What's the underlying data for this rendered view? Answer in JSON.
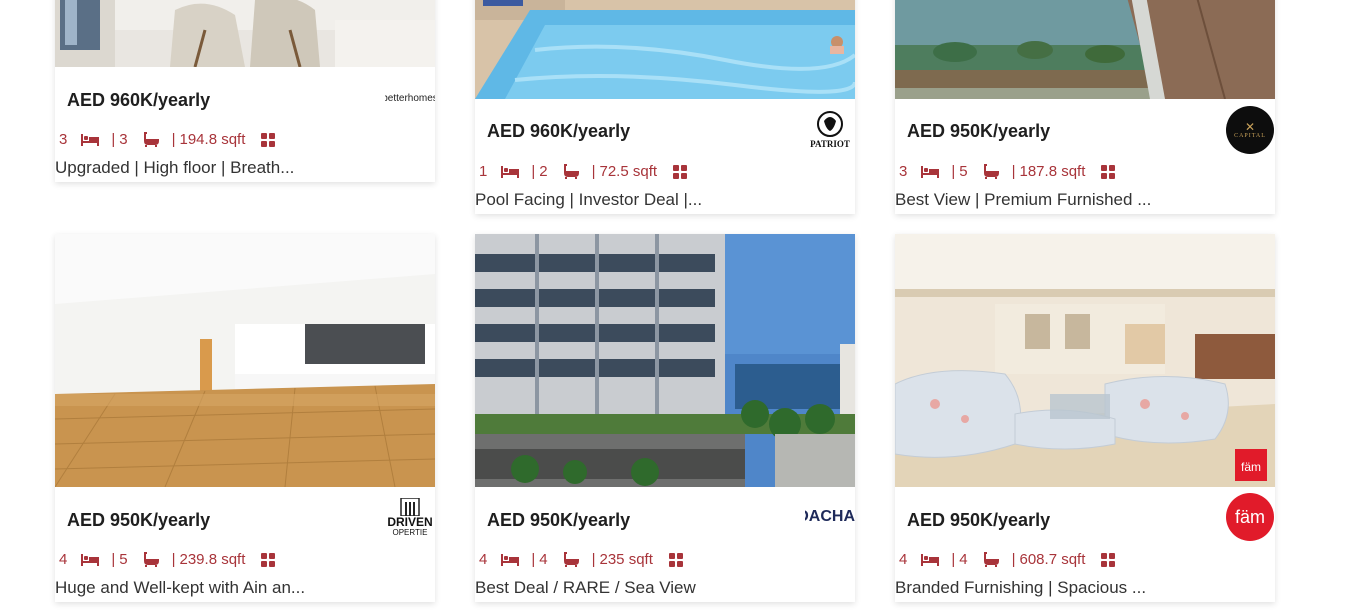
{
  "colors": {
    "accent": "#a8343a",
    "price": "#1f1f1f",
    "text": "#333333"
  },
  "listings": [
    {
      "price": "AED 960K/yearly",
      "beds": "3",
      "baths": "3",
      "area": "194.8 sqft",
      "title": "Upgraded | High floor | Breath...",
      "agency_text": "betterhomes",
      "bed_icon": "bed-icon",
      "bath_icon": "bath-icon",
      "plan_icon": "floor-plan-icon"
    },
    {
      "price": "AED 960K/yearly",
      "beds": "1",
      "baths": "2",
      "area": "72.5 sqft",
      "title": "Pool Facing | Investor Deal |...",
      "agency_text": "PATRIOT",
      "bed_icon": "bed-icon",
      "bath_icon": "bath-icon",
      "plan_icon": "floor-plan-icon"
    },
    {
      "price": "AED 950K/yearly",
      "beds": "3",
      "baths": "5",
      "area": "187.8 sqft",
      "title": "Best View | Premium Furnished ...",
      "agency_text": "CAPITAL",
      "bed_icon": "bed-icon",
      "bath_icon": "bath-icon",
      "plan_icon": "floor-plan-icon"
    },
    {
      "price": "AED 950K/yearly",
      "beds": "4",
      "baths": "5",
      "area": "239.8 sqft",
      "title": "Huge and Well-kept with Ain an...",
      "agency_text": "DRIVEN",
      "agency_sub": "OPERTIE",
      "bed_icon": "bed-icon",
      "bath_icon": "bath-icon",
      "plan_icon": "floor-plan-icon"
    },
    {
      "price": "AED 950K/yearly",
      "beds": "4",
      "baths": "4",
      "area": "235 sqft",
      "title": "Best Deal / RARE / Sea View",
      "agency_text": "DACHA",
      "bed_icon": "bed-icon",
      "bath_icon": "bath-icon",
      "plan_icon": "floor-plan-icon"
    },
    {
      "price": "AED 950K/yearly",
      "beds": "4",
      "baths": "4",
      "area": "608.7 sqft",
      "title": "Branded Furnishing | Spacious ...",
      "agency_text": "fäm",
      "badge_text": "fäm",
      "bed_icon": "bed-icon",
      "bath_icon": "bath-icon",
      "plan_icon": "floor-plan-icon"
    }
  ],
  "separator": "|"
}
